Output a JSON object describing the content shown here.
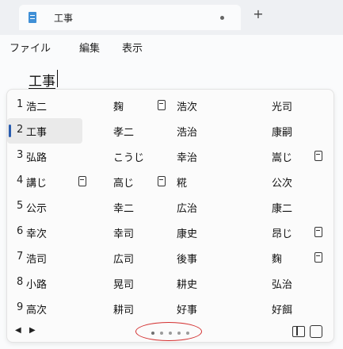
{
  "tab": {
    "title": "工事",
    "add_label": "+"
  },
  "menu": [
    "ファイル",
    "編集",
    "表示"
  ],
  "editor": {
    "text": "工事"
  },
  "candidates": {
    "rows": [
      {
        "num": "1",
        "c1": "浩二",
        "c2": "麹",
        "c2_badge": true,
        "c3": "浩次",
        "c4": "光司",
        "c4_badge": false,
        "c1_badge": false
      },
      {
        "num": "2",
        "c1": "工事",
        "c2": "孝二",
        "c2_badge": false,
        "c3": "浩治",
        "c4": "康嗣",
        "c4_badge": false,
        "c1_badge": false,
        "selected": true
      },
      {
        "num": "3",
        "c1": "弘路",
        "c2": "こうじ",
        "c2_badge": false,
        "c3": "幸治",
        "c4": "嵩じ",
        "c4_badge": true,
        "c1_badge": false
      },
      {
        "num": "4",
        "c1": "講じ",
        "c2": "高じ",
        "c2_badge": true,
        "c3": "糀",
        "c4": "公次",
        "c4_badge": false,
        "c1_badge": true
      },
      {
        "num": "5",
        "c1": "公示",
        "c2": "幸二",
        "c2_badge": false,
        "c3": "広治",
        "c4": "康二",
        "c4_badge": false,
        "c1_badge": false
      },
      {
        "num": "6",
        "c1": "幸次",
        "c2": "幸司",
        "c2_badge": false,
        "c3": "康史",
        "c4": "昂じ",
        "c4_badge": true,
        "c1_badge": false
      },
      {
        "num": "7",
        "c1": "浩司",
        "c2": "広司",
        "c2_badge": false,
        "c3": "後事",
        "c4": "麴",
        "c4_badge": true,
        "c1_badge": false
      },
      {
        "num": "8",
        "c1": "小路",
        "c2": "晃司",
        "c2_badge": false,
        "c3": "耕史",
        "c4": "弘治",
        "c4_badge": false,
        "c1_badge": false
      },
      {
        "num": "9",
        "c1": "高次",
        "c2": "耕司",
        "c2_badge": false,
        "c3": "好事",
        "c4": "好餌",
        "c4_badge": false,
        "c1_badge": false
      }
    ],
    "footer": {
      "prev": "◀",
      "next": "▶",
      "page_count": 5,
      "active_page": 1
    }
  }
}
